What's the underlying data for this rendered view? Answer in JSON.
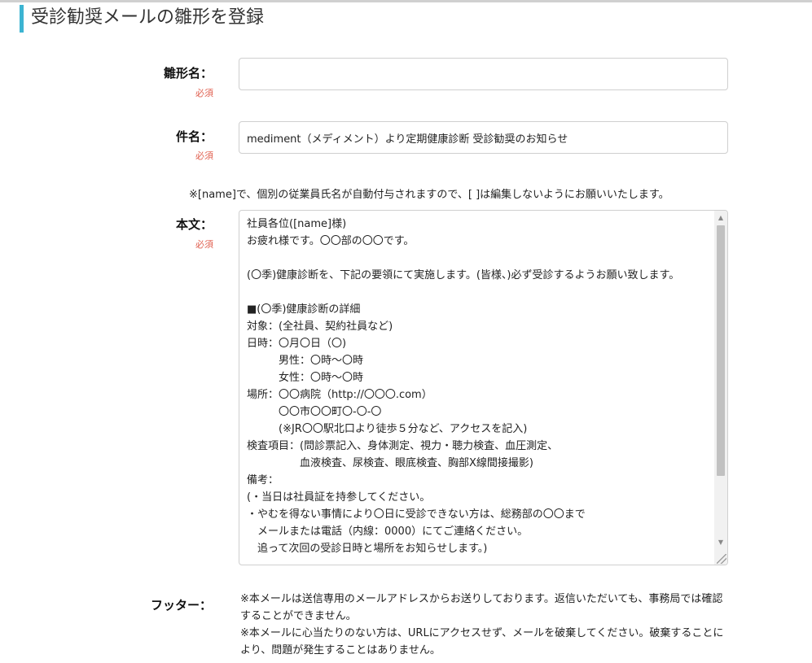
{
  "page": {
    "title": "受診勧奨メールの雛形を登録"
  },
  "form": {
    "template_name": {
      "label": "雛形名：",
      "required": "必須",
      "value": ""
    },
    "subject": {
      "label": "件名：",
      "required": "必須",
      "value": "mediment（メディメント）より定期健康診断 受診勧奨のお知らせ"
    },
    "name_note": "※[name]で、個別の従業員氏名が自動付与されますので、[ ]は編集しないようにお願いいたします。",
    "body": {
      "label": "本文：",
      "required": "必須",
      "lines": [
        "社員各位([name]様)",
        "お疲れ様です。〇〇部の〇〇です。",
        "",
        "(〇季)健康診断を、下記の要領にて実施します。(皆様、)必ず受診するようお願い致します。",
        "",
        "■(〇季)健康診断の詳細",
        "対象：(全社員、契約社員など)",
        "日時：〇月〇日（〇)",
        "　　　男性：〇時～〇時",
        "　　　女性：〇時～〇時",
        "場所：〇〇病院（http://〇〇〇.com）",
        "　　　〇〇市〇〇町〇-〇-〇",
        "　　　(※JR〇〇駅北口より徒歩５分など、アクセスを記入)",
        "検査項目：(問診票記入、身体測定、視力・聴力検査、血圧測定、",
        "　　　　　血液検査、尿検査、眼底検査、胸部X線間接撮影)",
        "備考：",
        "(・当日は社員証を持参してください。",
        "・やむを得ない事情により〇日に受診できない方は、総務部の〇〇まで",
        "　メールまたは電話（内線：0000）にてご連絡ください。",
        "　追って次回の受診日時と場所をお知らせします。)"
      ]
    },
    "footer": {
      "label": "フッター：",
      "lines": [
        "※本メールは送信専用のメールアドレスからお送りしております。返信いただいても、事務局では確認することができません。",
        "※本メールに心当たりのない方は、URLにアクセスせず、メールを破棄してください。破棄することにより、問題が発生することはありません。"
      ]
    }
  },
  "colors": {
    "accent": "#3cb4d2",
    "required": "#e06050"
  }
}
